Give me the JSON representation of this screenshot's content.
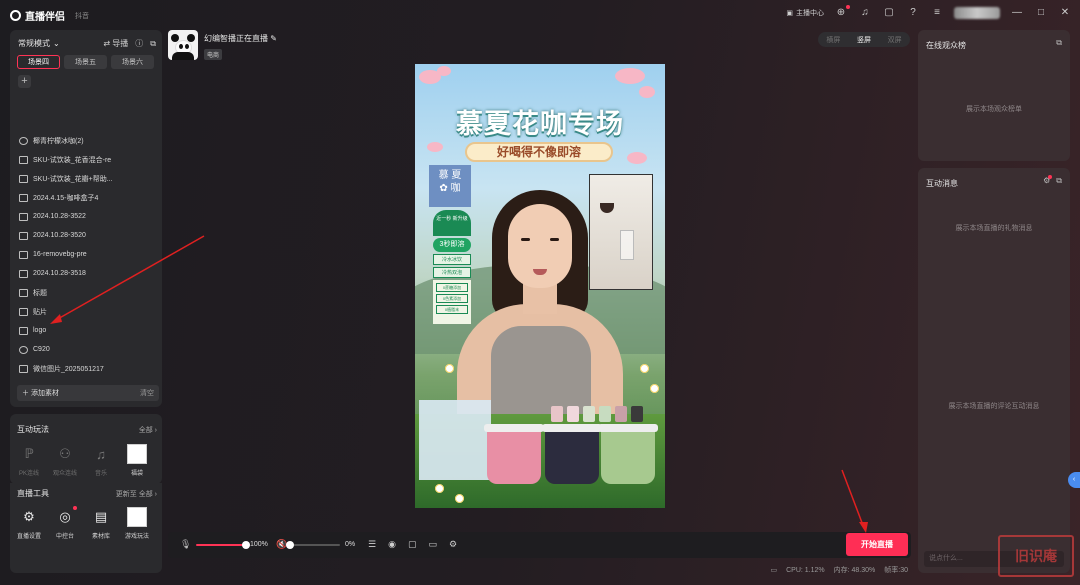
{
  "app": {
    "name": "直播伴侣",
    "platform": "抖音",
    "titlebar": {
      "anchor_center": "主播中心",
      "icons": [
        "upload-icon",
        "headset-icon",
        "message-icon",
        "help-icon",
        "menu-icon",
        "minimize-icon",
        "maximize-icon",
        "close-icon"
      ]
    }
  },
  "left": {
    "mode": "常规模式",
    "guide": "导播",
    "scenes": [
      "场景四",
      "场景五",
      "场景六"
    ],
    "active_scene": "场景四",
    "sources": [
      {
        "label": "椰青柠檬冰咖(2)",
        "icon": "play-icon"
      },
      {
        "label": "SKU-试饮装_花香混合-re",
        "icon": "image-icon"
      },
      {
        "label": "SKU-试饮装_花瓣+帮助...",
        "icon": "image-icon"
      },
      {
        "label": "2024.4.15-咖啡盒子4",
        "icon": "image-icon"
      },
      {
        "label": "2024.10.28-3522",
        "icon": "image-icon"
      },
      {
        "label": "2024.10.28-3520",
        "icon": "image-icon"
      },
      {
        "label": "16-removebg-pre",
        "icon": "image-icon"
      },
      {
        "label": "2024.10.28-3518",
        "icon": "image-icon"
      },
      {
        "label": "标题",
        "icon": "image-icon"
      },
      {
        "label": "贴片",
        "icon": "image-icon"
      },
      {
        "label": "logo",
        "icon": "image-icon"
      },
      {
        "label": "C920",
        "icon": "camera-icon"
      },
      {
        "label": "微信图片_2025051217",
        "icon": "image-icon"
      }
    ],
    "add_material": "添加素材",
    "clear": "清空",
    "interactive": {
      "title": "互动玩法",
      "more": "全部 ›",
      "items": [
        {
          "label": "PK连线",
          "icon": "pk-icon",
          "enabled": false
        },
        {
          "label": "观众连线",
          "icon": "link-icon",
          "enabled": false
        },
        {
          "label": "音乐",
          "icon": "music-icon",
          "enabled": false
        },
        {
          "label": "福袋",
          "icon": "lucky-bag-icon",
          "enabled": true
        }
      ]
    },
    "tools": {
      "title": "直播工具",
      "more_new": "更新至",
      "more": "全部 ›",
      "items": [
        {
          "label": "直播设置",
          "icon": "settings-icon"
        },
        {
          "label": "中控台",
          "icon": "control-icon"
        },
        {
          "label": "素材库",
          "icon": "library-icon"
        },
        {
          "label": "游戏玩法",
          "icon": "game-icon"
        }
      ]
    }
  },
  "center": {
    "streamer_name": "幻编智播正在直播",
    "streamer_tag": "电商",
    "view_modes": [
      "横屏",
      "竖屏",
      "双屏"
    ],
    "active_view": "竖屏",
    "preview": {
      "title": "慕夏花咖专场",
      "subtitle": "好喝得不像即溶",
      "brand": [
        "慕",
        "夏",
        "咖"
      ],
      "badges": {
        "top": "近一秒 新升级",
        "main": "3秒即溶",
        "tag1": "冷水冰饮",
        "tag2": "冷热双泡",
        "list": [
          "0蔗糖添加",
          "0色素添加",
          "0植脂末"
        ]
      }
    },
    "controls": {
      "mic_volume": "100%",
      "speaker_volume": "0%",
      "mic_level": 1.0,
      "speaker_level": 0.0
    },
    "start_button": "开始直播",
    "stats": {
      "cpu": "CPU: 1.12%",
      "memory": "内存: 48.30%",
      "fps": "帧率:30"
    }
  },
  "right": {
    "audience": {
      "title": "在线观众榜",
      "empty": "展示本场观众榜单"
    },
    "messages": {
      "title": "互动消息",
      "gift_empty": "展示本场直播的礼物消息",
      "comment_empty": "展示本场直播的评论互动消息",
      "input_placeholder": "说点什么..."
    }
  },
  "watermark": "旧识庵",
  "colors": {
    "accent": "#ff2e55",
    "panel": "#2a2a2d",
    "right_panel": "#3a2e31"
  }
}
